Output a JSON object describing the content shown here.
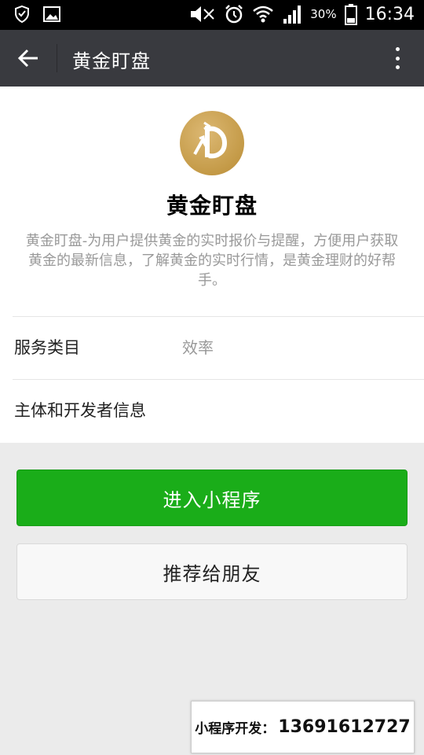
{
  "status_bar": {
    "time": "16:34",
    "battery_percent": "30%",
    "icons": [
      "shield-icon",
      "image-icon",
      "mute-icon",
      "alarm-icon",
      "wifi-icon",
      "signal-icon",
      "battery-icon"
    ]
  },
  "header": {
    "title": "黄金盯盘",
    "back_icon": "arrow-left-icon",
    "more_icon": "more-vertical-icon"
  },
  "app": {
    "name": "黄金盯盘",
    "description": "黄金盯盘-为用户提供黄金的实时报价与提醒，方便用户获取黄金的最新信息，了解黄金的实时行情，是黄金理财的好帮手。",
    "logo_color": "#c9a052"
  },
  "info_rows": [
    {
      "label": "服务类目",
      "value": "效率"
    },
    {
      "label": "主体和开发者信息",
      "value": ""
    }
  ],
  "buttons": {
    "enter_label": "进入小程序",
    "recommend_label": "推荐给朋友"
  },
  "promo": {
    "label": "小程序开发：",
    "phone": "13691612727"
  },
  "colors": {
    "header_bg": "#393a3f",
    "primary_green": "#1aad19",
    "page_bg": "#ebebeb"
  }
}
